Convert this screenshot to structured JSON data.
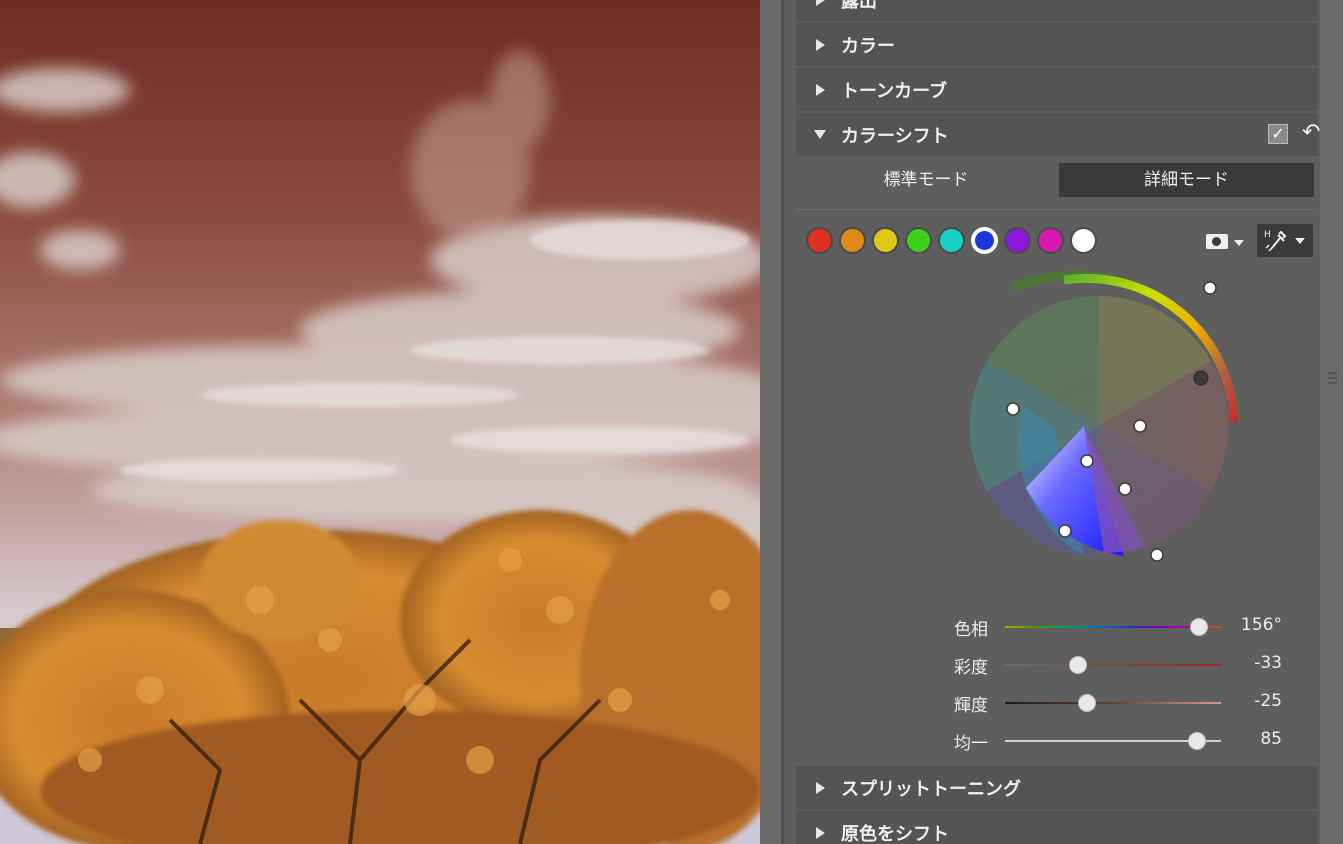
{
  "panel": {
    "sections": [
      {
        "label": "露出",
        "expanded": false
      },
      {
        "label": "カラー",
        "expanded": false
      },
      {
        "label": "トーンカーブ",
        "expanded": false
      },
      {
        "label": "カラーシフト",
        "expanded": true
      },
      {
        "label": "スプリットトーニング",
        "expanded": false
      },
      {
        "label": "原色をシフト",
        "expanded": false
      }
    ],
    "color_shift": {
      "enabled_check": "✓",
      "reset_icon": "undo-arrow-icon",
      "modes": {
        "standard": "標準モード",
        "detail": "詳細モード",
        "active": "detail"
      },
      "swatches": [
        {
          "name": "red",
          "color": "#e03020"
        },
        {
          "name": "orange",
          "color": "#e08a18"
        },
        {
          "name": "yellow",
          "color": "#e0c818"
        },
        {
          "name": "green",
          "color": "#3cd018"
        },
        {
          "name": "cyan",
          "color": "#18d0c4"
        },
        {
          "name": "blue",
          "color": "#1838d8",
          "selected": true
        },
        {
          "name": "purple",
          "color": "#8a18d8"
        },
        {
          "name": "magenta",
          "color": "#d818b0"
        },
        {
          "name": "white",
          "color": "#ffffff"
        }
      ],
      "mask_icon": "mask-icon",
      "picker_icon": "eyedropper-hsl-icon",
      "picker_text": "H",
      "sliders": [
        {
          "key": "hue",
          "label": "色相",
          "value": "156°",
          "position": 0.9
        },
        {
          "key": "sat",
          "label": "彩度",
          "value": "-33",
          "position": 0.34
        },
        {
          "key": "lum",
          "label": "輝度",
          "value": "-25",
          "position": 0.38
        },
        {
          "key": "uni",
          "label": "均一",
          "value": "85",
          "position": 0.89
        }
      ]
    }
  },
  "colors": {
    "panel_bg": "#5e5e5e",
    "header_bg": "#545454",
    "active_mode_bg": "#3a3a3a"
  }
}
